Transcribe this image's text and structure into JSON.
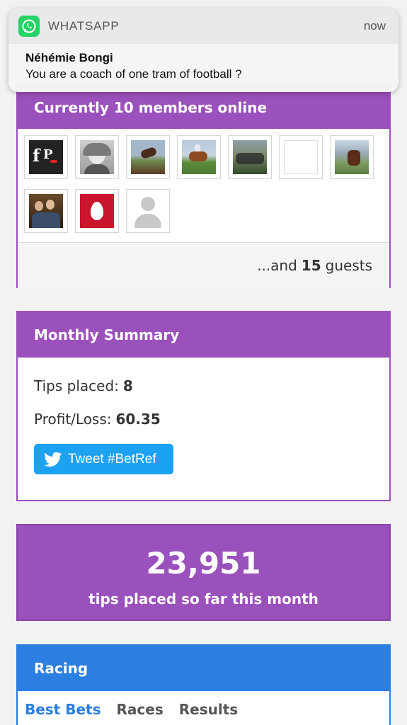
{
  "notification": {
    "app_name": "WHATSAPP",
    "time": "now",
    "sender": "Néhémie Bongi",
    "message": "You are a coach of one tram of football ?"
  },
  "online": {
    "title": "Currently 10 members online",
    "avatars": [
      "fp-logo-avatar",
      "woman-photo-avatar",
      "horse-jump-avatar",
      "horse-race-avatar",
      "racing-pack-avatar",
      "blank-avatar",
      "horse-track-avatar",
      "couple-photo-avatar",
      "egg-logo-avatar",
      "default-user-avatar"
    ],
    "guests_prefix": "...and",
    "guests_count": "15",
    "guests_suffix": "guests"
  },
  "monthly": {
    "title": "Monthly Summary",
    "tips_label": "Tips placed:",
    "tips_value": "8",
    "profit_label": "Profit/Loss:",
    "profit_value": "60.35",
    "tweet_label": "Tweet #BetRef"
  },
  "tips_banner": {
    "number": "23,951",
    "label": "tips placed so far this month"
  },
  "racing": {
    "title": "Racing",
    "tabs": [
      "Best Bets",
      "Races",
      "Results"
    ]
  },
  "colors": {
    "purple": "#9b51bc",
    "blue": "#2a7fe0",
    "twitter": "#1da1f2",
    "whatsapp": "#25d366"
  }
}
